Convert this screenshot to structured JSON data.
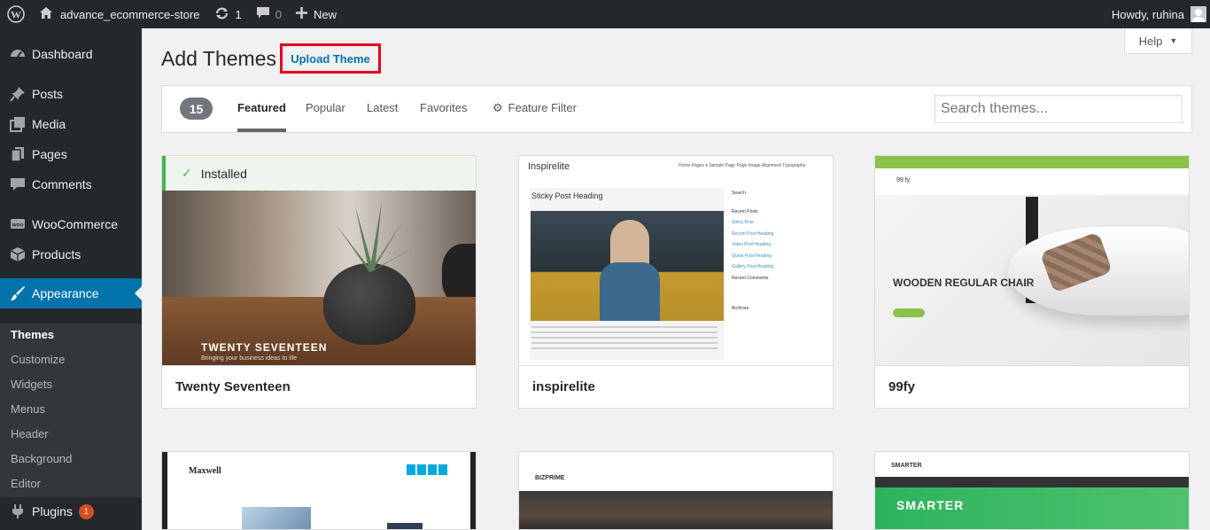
{
  "adminbar": {
    "site_name": "advance_ecommerce-store",
    "updates_count": "1",
    "comments_count": "0",
    "new_label": "New",
    "howdy": "Howdy, ruhina"
  },
  "sidebar": {
    "items": [
      {
        "label": "Dashboard",
        "icon": "dashboard-icon"
      },
      {
        "label": "Posts",
        "icon": "pin-icon"
      },
      {
        "label": "Media",
        "icon": "media-icon"
      },
      {
        "label": "Pages",
        "icon": "pages-icon"
      },
      {
        "label": "Comments",
        "icon": "comment-icon"
      },
      {
        "label": "WooCommerce",
        "icon": "woo-icon"
      },
      {
        "label": "Products",
        "icon": "box-icon"
      },
      {
        "label": "Appearance",
        "icon": "brush-icon"
      },
      {
        "label": "Plugins",
        "icon": "plug-icon",
        "badge": "1"
      }
    ],
    "submenu": [
      "Themes",
      "Customize",
      "Widgets",
      "Menus",
      "Header",
      "Background",
      "Editor"
    ]
  },
  "header": {
    "title": "Add Themes",
    "upload_label": "Upload Theme",
    "help_label": "Help"
  },
  "filter": {
    "count": "15",
    "tabs": [
      "Featured",
      "Popular",
      "Latest",
      "Favorites"
    ],
    "feature_filter": "Feature Filter",
    "search_placeholder": "Search themes..."
  },
  "themes": [
    {
      "name": "Twenty Seventeen",
      "installed_label": "Installed",
      "screenshot_title": "TWENTY SEVENTEEN",
      "screenshot_sub": "Bringing your business ideas to life"
    },
    {
      "name": "inspirelite",
      "screenshot_logo": "Inspirelite",
      "screenshot_nav": "Home   Pages ▾   Sample Page   Page Image Alignment   Typography",
      "screenshot_heading": "Sticky Post Heading",
      "screenshot_side": [
        "Search",
        "Recent Posts",
        "Sticky Post",
        "Recent Post Heading",
        "Video Post Heading",
        "Quote Post Heading",
        "Gallery Post Heading",
        "Recent Comments",
        "Archives"
      ]
    },
    {
      "name": "99fy",
      "screenshot_logo": "99 fy.",
      "screenshot_title": "WOODEN REGULAR CHAIR"
    }
  ],
  "themes_row2": [
    {
      "screenshot_logo": "Maxwell"
    },
    {
      "screenshot_logo": "BIZPRIME"
    },
    {
      "screenshot_logo": "SMARTER",
      "screenshot_title": "SMARTER"
    }
  ],
  "colors": {
    "accent": "#0073aa",
    "highlight_box": "#e60023",
    "installed_green": "#46b450"
  }
}
